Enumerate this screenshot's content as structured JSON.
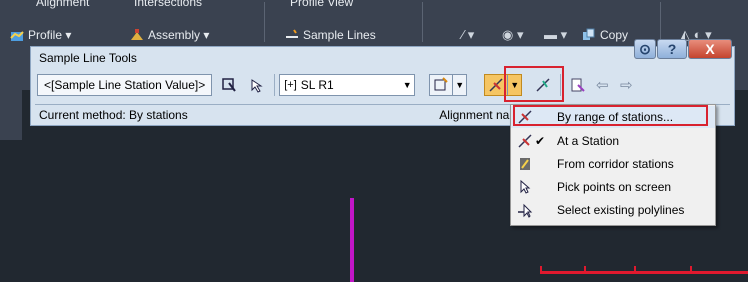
{
  "ribbon": {
    "row1": {
      "items": [
        {
          "label": "Alignment",
          "icon": "alignment-icon"
        },
        {
          "label": "Intersections",
          "icon": "intersection-icon"
        },
        {
          "label": "Profile View",
          "icon": "profile-view-icon"
        }
      ]
    },
    "row2": {
      "items": [
        {
          "label": "Profile ▾",
          "icon": "profile-icon"
        },
        {
          "label": "Assembly ▾",
          "icon": "assembly-icon"
        },
        {
          "label": "Sample Lines",
          "icon": "sample-lines-icon"
        },
        {
          "label": "Copy",
          "icon": "copy-icon"
        }
      ]
    }
  },
  "palette": {
    "title": "Sample Line Tools",
    "title_buttons": [
      "?",
      "X"
    ],
    "station_value": "<[Sample Line Station Value]>",
    "group_combo": "SL R1",
    "status_left": "Current method: By stations",
    "status_right": "Alignment name: RC"
  },
  "menu": {
    "items": [
      {
        "label": "By range of stations...",
        "icon": "range-stations-icon",
        "checked": false,
        "highlighted": true
      },
      {
        "label": "At a Station",
        "icon": "at-station-icon",
        "checked": true,
        "highlighted": false
      },
      {
        "label": "From corridor stations",
        "icon": "corridor-stations-icon",
        "checked": false,
        "highlighted": false
      },
      {
        "label": "Pick points on screen",
        "icon": "pick-points-icon",
        "checked": false,
        "highlighted": false
      },
      {
        "label": "Select existing polylines",
        "icon": "select-polylines-icon",
        "checked": false,
        "highlighted": false
      }
    ]
  },
  "colors": {
    "highlight_border": "#d8222f",
    "canvas": "#212830",
    "palette_bg": "#d7e3ef",
    "magenta_line": "#c216c8"
  }
}
